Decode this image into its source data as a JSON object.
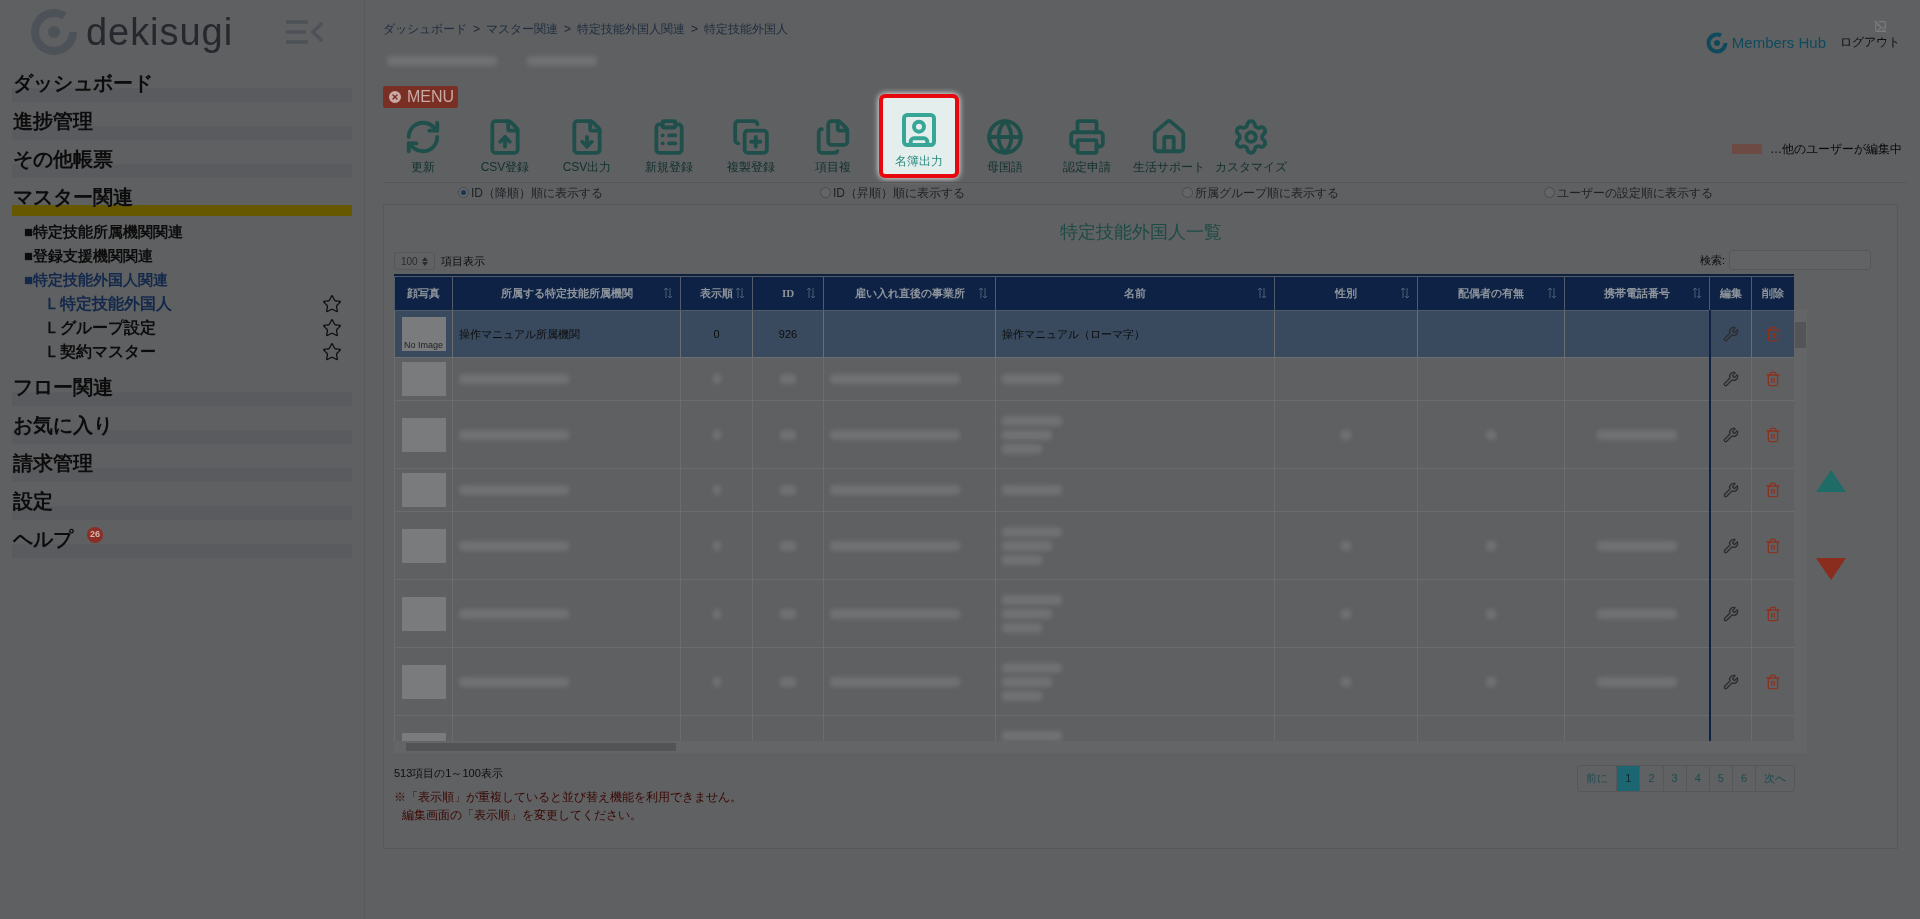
{
  "sidebar": {
    "logo": "dekisugi",
    "items": [
      {
        "label": "ダッシュボード",
        "selected": false
      },
      {
        "label": "進捗管理",
        "selected": false
      },
      {
        "label": "その他帳票",
        "selected": false
      },
      {
        "label": "マスター関連",
        "selected": true,
        "children": [
          {
            "label": "■特定技能所属機関関連",
            "selected": false
          },
          {
            "label": "■登録支援機関関連",
            "selected": false
          },
          {
            "label": "■特定技能外国人関連",
            "selected": true,
            "children": [
              {
                "label": "Ｌ特定技能外国人",
                "selected": true,
                "favorite": false
              },
              {
                "label": "Ｌグループ設定",
                "selected": false,
                "favorite": false
              },
              {
                "label": "Ｌ契約マスター",
                "selected": false,
                "favorite": false
              }
            ]
          }
        ]
      },
      {
        "label": "フロー関連",
        "selected": false
      },
      {
        "label": "お気に入り",
        "selected": false
      },
      {
        "label": "請求管理",
        "selected": false
      },
      {
        "label": "設定",
        "selected": false
      },
      {
        "label": "ヘルプ",
        "selected": false,
        "badge": "26"
      }
    ]
  },
  "header": {
    "breadcrumb": [
      "ダッシュボード",
      "マスター関連",
      "特定技能外国人関連",
      "特定技能外国人"
    ],
    "separator": ">",
    "brand": "Members Hub",
    "logout": "ログアウト"
  },
  "menu_button": "MENU",
  "toolbar": [
    {
      "label": "更新",
      "highlighted": false
    },
    {
      "label": "CSV登録",
      "highlighted": false
    },
    {
      "label": "CSV出力",
      "highlighted": false
    },
    {
      "label": "新規登録",
      "highlighted": false
    },
    {
      "label": "複製登録",
      "highlighted": false
    },
    {
      "label": "項目複",
      "highlighted": false
    },
    {
      "label": "名簿出力",
      "highlighted": true
    },
    {
      "label": "母国語",
      "highlighted": false
    },
    {
      "label": "認定申請",
      "highlighted": false
    },
    {
      "label": "生活サポート",
      "highlighted": false
    },
    {
      "label": "カスタマイズ",
      "highlighted": false
    }
  ],
  "legend": "…他のユーザーが編集中",
  "sort_options": [
    {
      "label": "ID（降順）順に表示する",
      "selected": true
    },
    {
      "label": "ID（昇順）順に表示する",
      "selected": false
    },
    {
      "label": "所属グループ順に表示する",
      "selected": false
    },
    {
      "label": "ユーザーの設定順に表示する",
      "selected": false
    }
  ],
  "list": {
    "title": "特定技能外国人一覧",
    "page_size": "100",
    "page_size_label": "項目表示",
    "search_label": "検索:",
    "columns": [
      {
        "label": "顔写真",
        "sortable": false
      },
      {
        "label": "所属する特定技能所属機関",
        "sortable": true
      },
      {
        "label": "表示順",
        "sortable": true
      },
      {
        "label": "ID",
        "sortable": true
      },
      {
        "label": "雇い入れ直後の事業所",
        "sortable": true
      },
      {
        "label": "名前",
        "sortable": true
      },
      {
        "label": "性別",
        "sortable": true
      },
      {
        "label": "配偶者の有無",
        "sortable": true
      },
      {
        "label": "携帯電話番号",
        "sortable": true
      },
      {
        "label": "編集",
        "sortable": false
      },
      {
        "label": "削除",
        "sortable": false
      }
    ],
    "rows": [
      {
        "kind": "data",
        "selected": true,
        "photo": "No Image",
        "agency": "操作マニュアル所属機関",
        "order": "0",
        "id": "926",
        "name": "操作マニュアル（ローマ字）"
      },
      {
        "kind": "blurred",
        "selected": false,
        "tall": false
      },
      {
        "kind": "blurred",
        "selected": false,
        "tall": true
      },
      {
        "kind": "blurred",
        "selected": false,
        "tall": false
      },
      {
        "kind": "blurred",
        "selected": false,
        "tall": true
      },
      {
        "kind": "blurred",
        "selected": false,
        "tall": true
      },
      {
        "kind": "blurred",
        "selected": false,
        "tall": true
      },
      {
        "kind": "blurred",
        "selected": false,
        "tall": true
      }
    ],
    "summary": "513項目の1～100表示",
    "pages": [
      {
        "label": "前に",
        "selected": false
      },
      {
        "label": "1",
        "selected": true
      },
      {
        "label": "2",
        "selected": false
      },
      {
        "label": "3",
        "selected": false
      },
      {
        "label": "4",
        "selected": false
      },
      {
        "label": "5",
        "selected": false
      },
      {
        "label": "6",
        "selected": false
      },
      {
        "label": "次へ",
        "selected": false
      }
    ],
    "notes": [
      "※「表示順」が重複していると並び替え機能を利用できません。",
      "編集画面の「表示順」を変更してください。"
    ]
  }
}
